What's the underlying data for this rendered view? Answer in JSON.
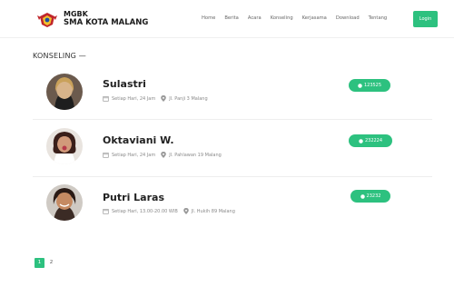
{
  "brand": {
    "line1": "MGBK",
    "line2": "SMA KOTA MALANG"
  },
  "nav": {
    "items": [
      "Home",
      "Berita",
      "Acara",
      "Konseling",
      "Kerjasama",
      "Download",
      "Tentang"
    ],
    "login": "Login"
  },
  "section": {
    "title": "KONSELING —"
  },
  "counselors": [
    {
      "name": "Sulastri",
      "schedule": "Setiap Hari, 24 Jam",
      "address": "Jl. Panji 3 Malang",
      "phone": "123525"
    },
    {
      "name": "Oktaviani W.",
      "schedule": "Setiap Hari, 24 Jam",
      "address": "Jl. Pahlawan 19 Malang",
      "phone": "232224"
    },
    {
      "name": "Putri Laras",
      "schedule": "Setiap Hari, 13.00-20.00 WIB",
      "address": "Jl. Hukih 89 Malang",
      "phone": "23232"
    }
  ],
  "pagination": {
    "pages": [
      "1",
      "2"
    ],
    "active": "1"
  },
  "colors": {
    "accent": "#2dc17f",
    "text": "#222222",
    "muted": "#8a8a8a"
  },
  "icons": {
    "calendar": "calendar-icon",
    "location": "map-pin-icon",
    "whatsapp": "whatsapp-icon"
  }
}
